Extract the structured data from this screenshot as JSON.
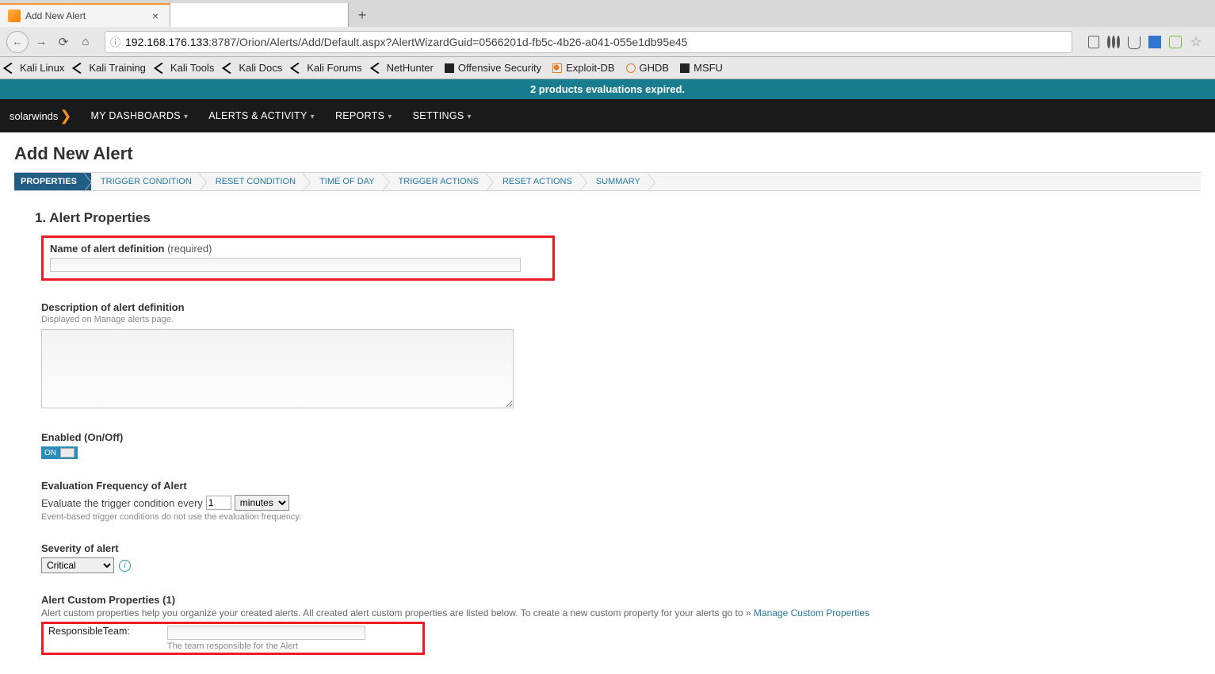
{
  "browser": {
    "tab_title": "Add New Alert",
    "url_host": "192.168.176.133",
    "url_rest": ":8787/Orion/Alerts/Add/Default.aspx?AlertWizardGuid=0566201d-fb5c-4b26-a041-055e1db95e45",
    "bookmarks": [
      "Kali Linux",
      "Kali Training",
      "Kali Tools",
      "Kali Docs",
      "Kali Forums",
      "NetHunter",
      "Offensive Security",
      "Exploit-DB",
      "GHDB",
      "MSFU"
    ]
  },
  "banner": "2 products evaluations expired.",
  "brand": "solarwinds",
  "nav": [
    "MY DASHBOARDS",
    "ALERTS & ACTIVITY",
    "REPORTS",
    "SETTINGS"
  ],
  "page_title": "Add New Alert",
  "wizard_steps": [
    "PROPERTIES",
    "TRIGGER CONDITION",
    "RESET CONDITION",
    "TIME OF DAY",
    "TRIGGER ACTIONS",
    "RESET ACTIONS",
    "SUMMARY"
  ],
  "section_heading": "1. Alert Properties",
  "fields": {
    "name_label": "Name of alert definition",
    "name_hint": "(required)",
    "name_value": "",
    "desc_label": "Description of alert definition",
    "desc_hint": "Displayed on Manage alerts page.",
    "desc_value": "",
    "enabled_label": "Enabled (On/Off)",
    "toggle_state": "ON",
    "freq_label": "Evaluation Frequency of Alert",
    "freq_text": "Evaluate the trigger condition every",
    "freq_value": "1",
    "freq_unit": "minutes",
    "freq_hint": "Event-based trigger conditions do not use the evaluation frequency.",
    "severity_label": "Severity of alert",
    "severity_value": "Critical",
    "custom_heading": "Alert Custom Properties (1)",
    "custom_desc": "Alert custom properties help you organize your created alerts. All created alert custom properties are listed below. To create a new custom property for your alerts go to »",
    "custom_link": "Manage Custom Properties",
    "cp_name": "ResponsibleTeam:",
    "cp_value": "",
    "cp_hint": "The team responsible for the Alert"
  }
}
